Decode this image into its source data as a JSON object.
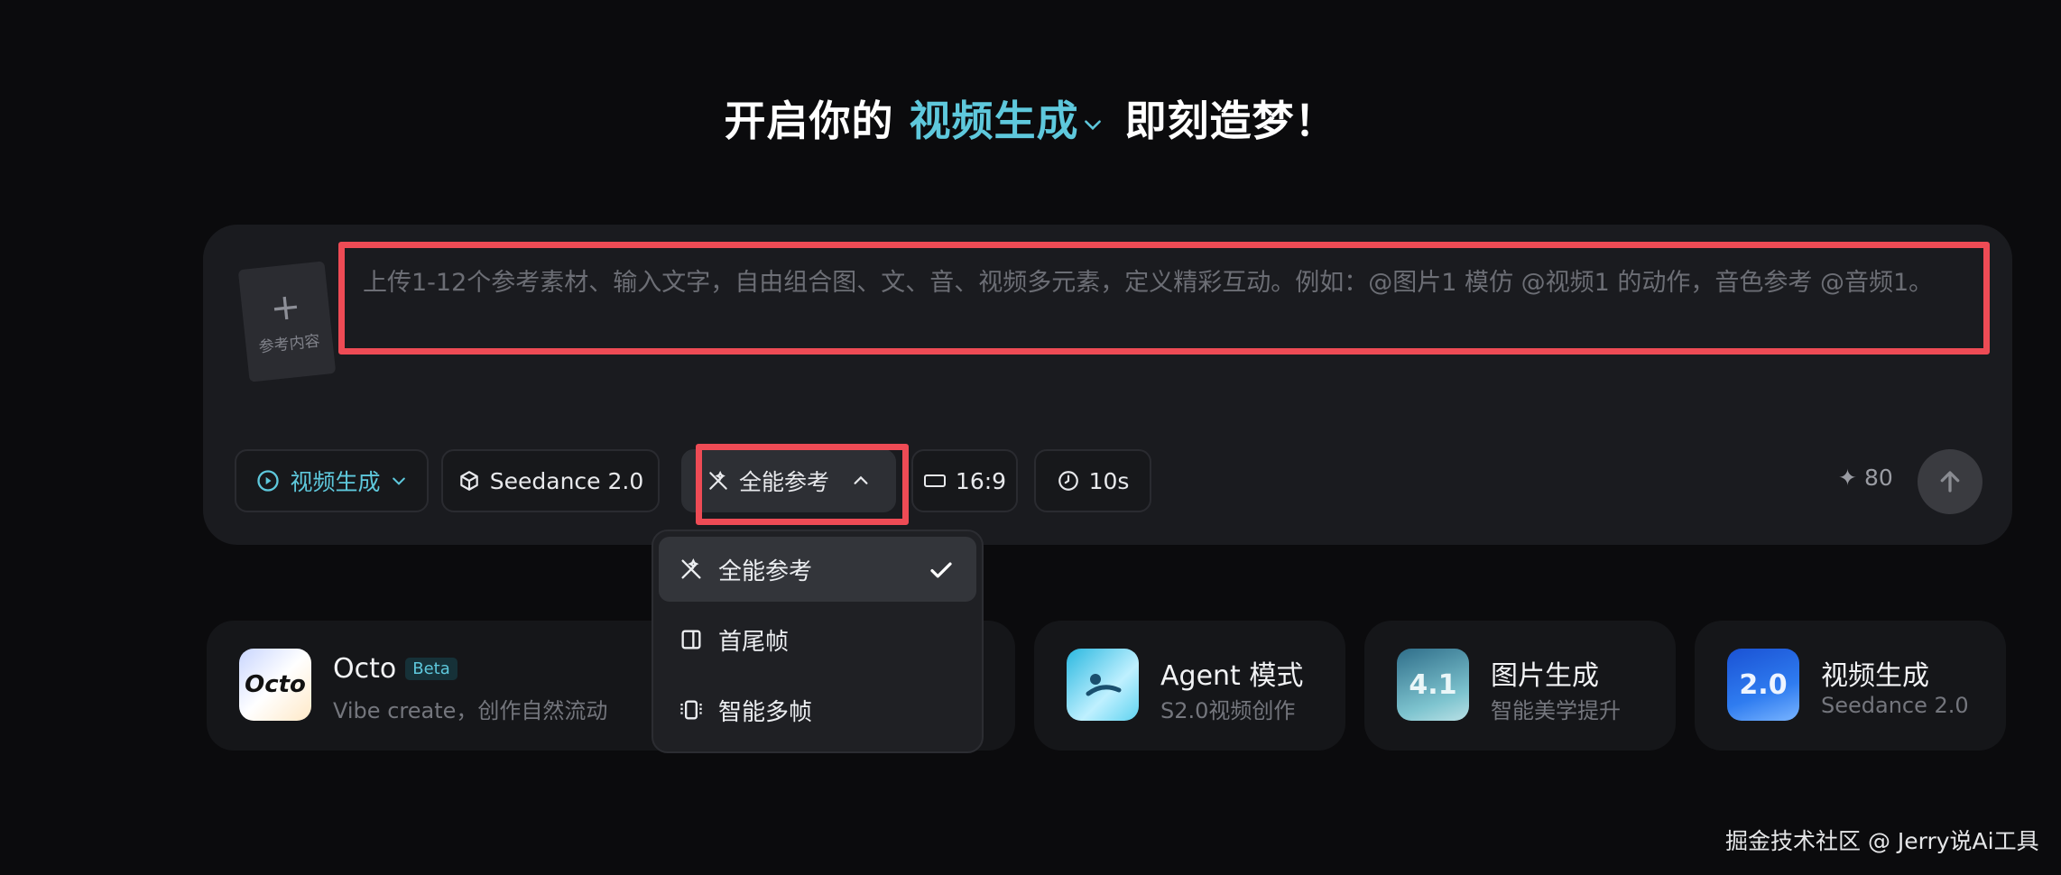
{
  "headline": {
    "prefix": "开启你的",
    "mode": "视频生成",
    "suffix": "即刻造梦！"
  },
  "composer": {
    "reference_label": "参考内容",
    "prompt_placeholder": "上传1-12个参考素材、输入文字，自由组合图、文、音、视频多元素，定义精彩互动。例如：@图片1 模仿 @视频1 的动作，音色参考 @音频1。"
  },
  "toolbar": {
    "mode_label": "视频生成",
    "model_label": "Seedance 2.0",
    "reference_label": "全能参考",
    "ratio_label": "16:9",
    "duration_label": "10s",
    "credits": "80"
  },
  "dropdown": {
    "items": [
      {
        "label": "全能参考",
        "selected": true,
        "icon": "magic-wand-icon"
      },
      {
        "label": "首尾帧",
        "selected": false,
        "icon": "frame-icon"
      },
      {
        "label": "智能多帧",
        "selected": false,
        "icon": "multi-frame-icon"
      }
    ]
  },
  "cards": [
    {
      "title": "Octo",
      "badge": "Beta",
      "subtitle": "Vibe create，创作自然流动",
      "icon_text": "Octo"
    },
    {
      "title": "Agent 模式",
      "subtitle": "S2.0视频创作"
    },
    {
      "title": "图片生成",
      "subtitle": "智能美学提升",
      "icon_text": "4.1"
    },
    {
      "title": "视频生成",
      "subtitle": "Seedance 2.0",
      "icon_text": "2.0"
    }
  ],
  "watermark": "掘金技术社区 @ Jerry说Ai工具",
  "colors": {
    "background": "#0b0b0d",
    "accent": "#5ec8dc",
    "highlight": "#ee4b55"
  }
}
